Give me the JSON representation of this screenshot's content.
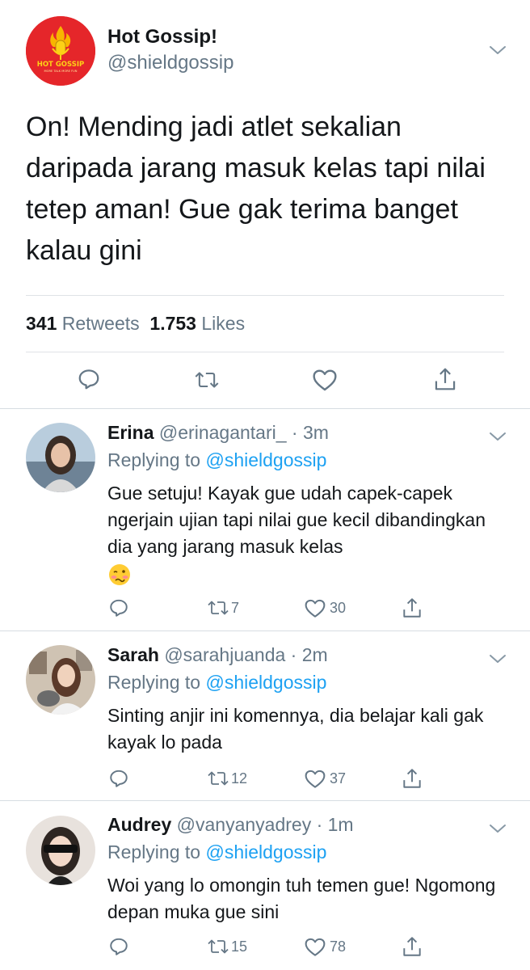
{
  "main_tweet": {
    "account_name": "Hot Gossip!",
    "handle": "@shieldgossip",
    "logo_text": "HOT GOSSIP",
    "logo_subtext": "MORE TALK MORE FUN",
    "text": "On! Mending jadi atlet sekalian daripada jarang masuk kelas tapi nilai tetep aman! Gue gak terima banget kalau gini",
    "retweet_count": "341",
    "retweet_label": "Retweets",
    "like_count": "1.753",
    "like_label": "Likes"
  },
  "replies": [
    {
      "name": "Erina",
      "handle": "@erinagantari_",
      "time": "· 3m",
      "replying_label": "Replying to",
      "replying_to": "@shieldgossip",
      "text": "Gue setuju! Kayak gue udah capek-capek ngerjain ujian tapi nilai gue kecil dibandingkan dia yang jarang masuk kelas",
      "emoji": "woozy-face",
      "retweets": "7",
      "likes": "30"
    },
    {
      "name": "Sarah",
      "handle": "@sarahjuanda",
      "time": "· 2m",
      "replying_label": "Replying to",
      "replying_to": "@shieldgossip",
      "text": "Sinting anjir ini komennya, dia belajar kali gak kayak lo pada",
      "retweets": "12",
      "likes": "37"
    },
    {
      "name": "Audrey",
      "handle": "@vanyanyadrey",
      "time": "· 1m",
      "replying_label": "Replying to",
      "replying_to": "@shieldgossip",
      "text": "Woi yang lo omongin tuh temen gue! Ngomong depan muka gue sini",
      "retweets": "15",
      "likes": "78"
    }
  ],
  "colors": {
    "link": "#1da1f2",
    "secondary_text": "#657786",
    "logo_red": "#e5262a"
  }
}
